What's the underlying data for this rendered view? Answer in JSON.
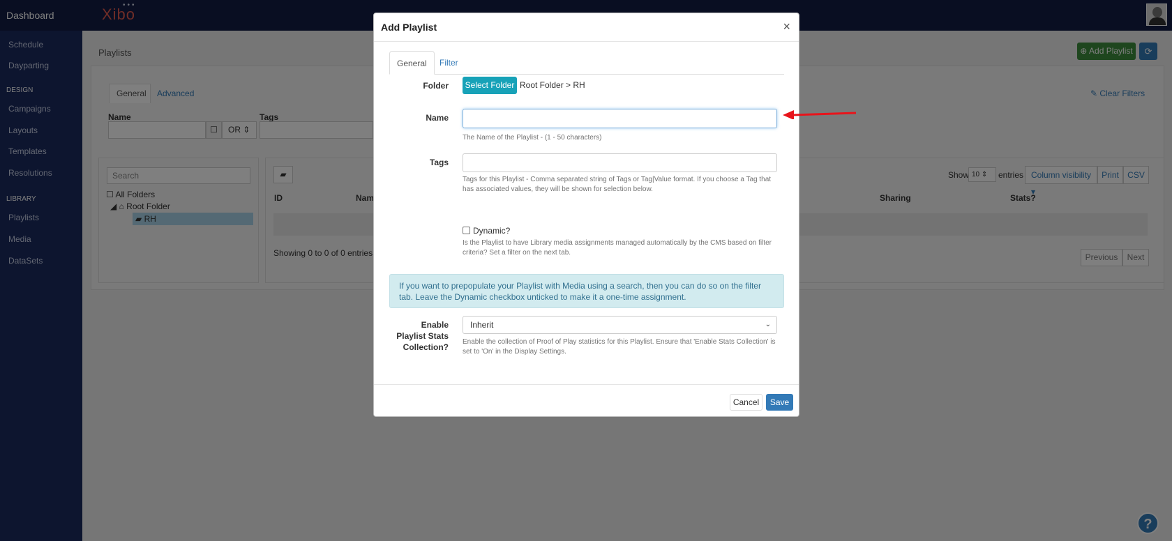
{
  "topbar": {
    "brand": "Dashboard",
    "logo": "Xibo"
  },
  "sidebar": {
    "items_top": [
      "Schedule",
      "Dayparting"
    ],
    "section_design": "DESIGN",
    "items_design": [
      "Campaigns",
      "Layouts",
      "Templates",
      "Resolutions"
    ],
    "section_library": "LIBRARY",
    "items_library": [
      "Playlists",
      "Media",
      "DataSets"
    ]
  },
  "page": {
    "title": "Playlists",
    "add_button": "Add Playlist",
    "filter_tabs": [
      "General",
      "Advanced"
    ],
    "filter_name_label": "Name",
    "filter_tags_label": "Tags",
    "filter_operator": "OR",
    "clear_filters": "Clear Filters",
    "folder_search_placeholder": "Search",
    "all_folders": "All Folders",
    "root_folder": "Root Folder",
    "subfolder": "RH",
    "show_label": "Show",
    "entries_count": "10",
    "entries_label": "entries",
    "column_visibility": "Column visibility",
    "print": "Print",
    "csv": "CSV",
    "columns": [
      "ID",
      "Nam",
      "Sharing",
      "Stats?"
    ],
    "showing_text": "Showing 0 to 0 of 0 entries",
    "previous": "Previous",
    "next": "Next"
  },
  "modal": {
    "title": "Add Playlist",
    "close": "×",
    "tabs": [
      "General",
      "Filter"
    ],
    "folder_label": "Folder",
    "select_folder_button": "Select Folder",
    "folder_path": "Root Folder > RH",
    "name_label": "Name",
    "name_value": "",
    "name_help": "The Name of the Playlist - (1 - 50 characters)",
    "tags_label": "Tags",
    "tags_value": "",
    "tags_help": "Tags for this Playlist - Comma separated string of Tags or Tag|Value format. If you choose a Tag that has associated values, they will be shown for selection below.",
    "dynamic_label": "Dynamic?",
    "dynamic_help": "Is the Playlist to have Library media assignments managed automatically by the CMS based on filter criteria? Set a filter on the next tab.",
    "info_text": "If you want to prepopulate your Playlist with Media using a search, then you can do so on the filter tab. Leave the Dynamic checkbox unticked to make it a one-time assignment.",
    "stats_label_lines": [
      "Enable",
      "Playlist Stats",
      "Collection?"
    ],
    "stats_value": "Inherit",
    "stats_help": "Enable the collection of Proof of Play statistics for this Playlist. Ensure that 'Enable Stats Collection' is set to 'On' in the Display Settings.",
    "cancel_button": "Cancel",
    "save_button": "Save"
  },
  "help_button": "?",
  "colors": {
    "topbar": "#121c44",
    "sidebar": "#1a2a5e",
    "primary": "#337ab7",
    "info": "#17a2b8",
    "success": "#3c8d3c",
    "annotation": "#e8141b"
  }
}
